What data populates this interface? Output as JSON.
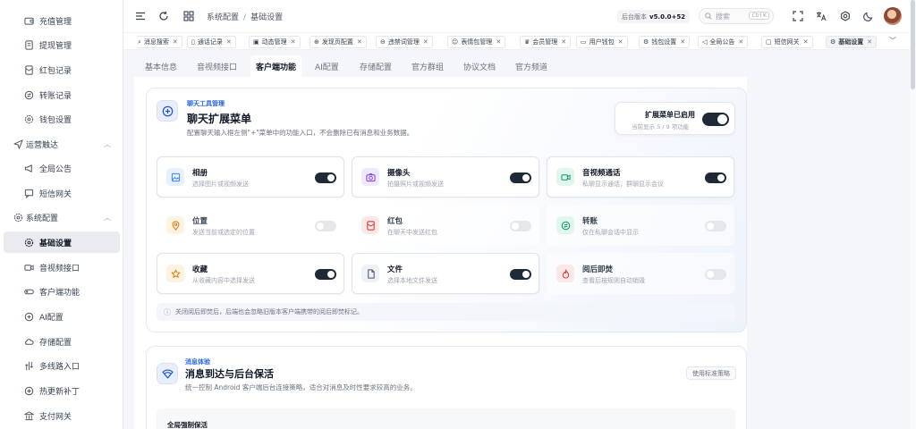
{
  "sidebar": {
    "items": [
      {
        "label": "充值管理",
        "icon": "wallet-icon"
      },
      {
        "label": "提现管理",
        "icon": "document-icon"
      },
      {
        "label": "红包记录",
        "icon": "red-packet-icon"
      },
      {
        "label": "转账记录",
        "icon": "transfer-icon"
      },
      {
        "label": "钱包设置",
        "icon": "settings-icon"
      }
    ],
    "group_ops": {
      "label": "运营触达",
      "icon": "send-icon"
    },
    "ops_items": [
      {
        "label": "全局公告",
        "icon": "megaphone-icon"
      },
      {
        "label": "短信网关",
        "icon": "message-icon"
      }
    ],
    "group_sys": {
      "label": "系统配置",
      "icon": "gear-icon"
    },
    "sys_items": [
      {
        "label": "基础设置",
        "icon": "settings-icon",
        "active": true
      },
      {
        "label": "音视频接口",
        "icon": "video-icon"
      },
      {
        "label": "客户端功能",
        "icon": "toggle-icon"
      },
      {
        "label": "AI配置",
        "icon": "ai-icon"
      },
      {
        "label": "存储配置",
        "icon": "cloud-icon"
      },
      {
        "label": "多线路入口",
        "icon": "route-icon"
      },
      {
        "label": "热更新补丁",
        "icon": "patch-icon"
      },
      {
        "label": "支付网关",
        "icon": "bank-icon"
      }
    ]
  },
  "header": {
    "breadcrumb": [
      "系统配置",
      "基础设置"
    ],
    "version_label": "后台版本",
    "version": "v5.0.0+52",
    "search_placeholder": "搜索",
    "search_kbd": "Ctrl K"
  },
  "tabs": [
    {
      "label": "消息搜索",
      "icon": "search-icon"
    },
    {
      "label": "通话记录",
      "icon": "bookmark-icon"
    },
    {
      "label": "动态管理",
      "icon": "image-icon"
    },
    {
      "label": "发现页配置",
      "icon": "compass-icon"
    },
    {
      "label": "违禁词管理",
      "icon": "forbid-icon"
    },
    {
      "label": "表情包管理",
      "icon": "smile-icon"
    },
    {
      "label": "会员管理",
      "icon": "crown-icon"
    },
    {
      "label": "用户钱包",
      "icon": "wallet-icon"
    },
    {
      "label": "钱包设置",
      "icon": "settings-icon"
    },
    {
      "label": "全局公告",
      "icon": "megaphone-icon"
    },
    {
      "label": "短信网关",
      "icon": "message-icon"
    },
    {
      "label": "基础设置",
      "icon": "settings-icon",
      "active": true
    }
  ],
  "subtabs": [
    "基本信息",
    "音视频接口",
    "客户端功能",
    "AI配置",
    "存储配置",
    "官方群组",
    "协议文档",
    "官方频道"
  ],
  "card1": {
    "kicker": "聊天工具管理",
    "title": "聊天扩展菜单",
    "desc": "配置聊天输入框左侧\"+\"菜单中的功能入口，不会删除已有消息和业务数据。",
    "ext_title": "扩展菜单已启用",
    "ext_sub": "当前显示 5 / 9 项功能",
    "features": [
      {
        "name": "相册",
        "desc": "选择图片或视频发送",
        "on": true,
        "icon": "album-icon",
        "color": "#3b82f6",
        "bg": "#e8f0fe"
      },
      {
        "name": "摄像头",
        "desc": "拍摄照片或视频发送",
        "on": true,
        "icon": "camera-icon",
        "color": "#7c3aed",
        "bg": "#efe9fd"
      },
      {
        "name": "音视频通话",
        "desc": "私聊显示通话，群聊显示会议",
        "on": true,
        "icon": "video-call-icon",
        "color": "#059669",
        "bg": "#e3f6ee"
      },
      {
        "name": "位置",
        "desc": "发送当前或选定的位置",
        "on": false,
        "icon": "location-icon",
        "color": "#d97706",
        "bg": "#fdf3e1"
      },
      {
        "name": "红包",
        "desc": "在聊天中发送红包",
        "on": false,
        "icon": "red-packet-icon",
        "color": "#dc2626",
        "bg": "#fde8e8"
      },
      {
        "name": "转账",
        "desc": "仅在私聊会话中显示",
        "on": false,
        "icon": "transfer-icon",
        "color": "#059669",
        "bg": "#e3f6ee"
      },
      {
        "name": "收藏",
        "desc": "从收藏内容中选择发送",
        "on": true,
        "icon": "star-icon",
        "color": "#d97706",
        "bg": "#fdf3e1"
      },
      {
        "name": "文件",
        "desc": "选择本地文件发送",
        "on": true,
        "icon": "file-icon",
        "color": "#475569",
        "bg": "#eef1f5"
      },
      {
        "name": "阅后即焚",
        "desc": "查看后按规则自动销毁",
        "on": false,
        "icon": "fire-icon",
        "color": "#dc2626",
        "bg": "#fde8e8"
      }
    ],
    "note": "关闭阅后即焚后，后端也会忽略旧版本客户端携带的阅后即焚标记。"
  },
  "card2": {
    "kicker": "消息体验",
    "title": "消息到达与后台保活",
    "desc": "统一控制 Android 客户端后台连接策略，适合对消息及时性要求较高的业务。",
    "std_button": "使用标准策略",
    "subsection": "全局强制保活"
  }
}
